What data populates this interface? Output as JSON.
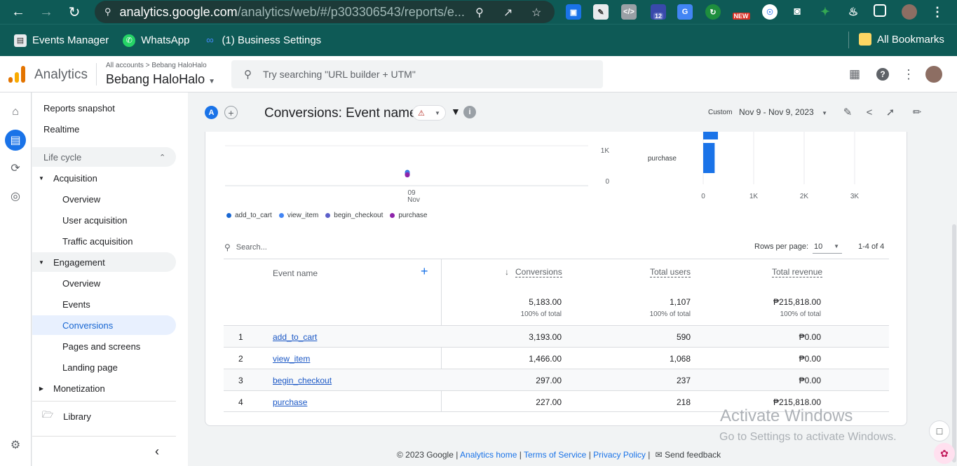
{
  "browser": {
    "url_host": "analytics.google.com",
    "url_path": "/analytics/web/#/p303306543/reports/e...",
    "bookmarks": [
      {
        "label": "Events Manager"
      },
      {
        "label": "WhatsApp"
      },
      {
        "label": "(1) Business Settings"
      }
    ],
    "all_bookmarks": "All Bookmarks",
    "ext_badge_12": "12",
    "ext_badge_new": "NEW"
  },
  "header": {
    "app_name": "Analytics",
    "breadcrumb_root": "All accounts",
    "breadcrumb_account": "Bebang HaloHalo",
    "property": "Bebang HaloHalo",
    "search_placeholder": "Try searching \"URL builder + UTM\""
  },
  "nav": {
    "reports_snapshot": "Reports snapshot",
    "realtime": "Realtime",
    "life_cycle": "Life cycle",
    "acquisition": "Acquisition",
    "acq_overview": "Overview",
    "user_acquisition": "User acquisition",
    "traffic_acquisition": "Traffic acquisition",
    "engagement": "Engagement",
    "eng_overview": "Overview",
    "events": "Events",
    "conversions": "Conversions",
    "pages_and_screens": "Pages and screens",
    "landing_page": "Landing page",
    "monetization": "Monetization",
    "library": "Library"
  },
  "toolbar": {
    "comparison_badge": "A",
    "title": "Conversions: Event name",
    "date_label": "Custom",
    "date_range": "Nov 9 - Nov 9, 2023"
  },
  "chart_data": [
    {
      "type": "line",
      "x": [
        "09 Nov"
      ],
      "ytick_labels": [
        "1K",
        "0"
      ],
      "xtick_day": "09",
      "xtick_month": "Nov",
      "series": [
        {
          "name": "add_to_cart",
          "color": "#1967d2",
          "values": [
            3193
          ]
        },
        {
          "name": "view_item",
          "color": "#4285f4",
          "values": [
            1466
          ]
        },
        {
          "name": "begin_checkout",
          "color": "#5c5fc9",
          "values": [
            297
          ]
        },
        {
          "name": "purchase",
          "color": "#8e24aa",
          "values": [
            227
          ]
        }
      ]
    },
    {
      "type": "bar",
      "categories": [
        "purchase"
      ],
      "values": [
        227
      ],
      "xlim": [
        0,
        3000
      ],
      "xtick_labels": [
        "0",
        "1K",
        "2K",
        "3K"
      ],
      "color": "#1a73e8"
    }
  ],
  "table": {
    "search_placeholder": "Search...",
    "rows_per_page_label": "Rows per page:",
    "rows_per_page": "10",
    "pagination": "1-4 of 4",
    "columns": {
      "event_name": "Event name",
      "conversions": "Conversions",
      "total_users": "Total users",
      "total_revenue": "Total revenue"
    },
    "totals": {
      "conversions": "5,183.00",
      "conversions_pct": "100% of total",
      "total_users": "1,107",
      "total_users_pct": "100% of total",
      "total_revenue": "₱215,818.00",
      "total_revenue_pct": "100% of total"
    },
    "rows": [
      {
        "idx": "1",
        "name": "add_to_cart",
        "conversions": "3,193.00",
        "users": "590",
        "revenue": "₱0.00"
      },
      {
        "idx": "2",
        "name": "view_item",
        "conversions": "1,466.00",
        "users": "1,068",
        "revenue": "₱0.00"
      },
      {
        "idx": "3",
        "name": "begin_checkout",
        "conversions": "297.00",
        "users": "237",
        "revenue": "₱0.00"
      },
      {
        "idx": "4",
        "name": "purchase",
        "conversions": "227.00",
        "users": "218",
        "revenue": "₱215,818.00"
      }
    ]
  },
  "footer": {
    "copyright": "© 2023 Google |",
    "analytics_home": "Analytics home",
    "sep1": "|",
    "terms": "Terms of Service",
    "sep2": "|",
    "privacy": "Privacy Policy",
    "sep3": "|",
    "feedback": "Send feedback"
  },
  "watermark": {
    "line1": "Activate Windows",
    "line2": "Go to Settings to activate Windows."
  }
}
